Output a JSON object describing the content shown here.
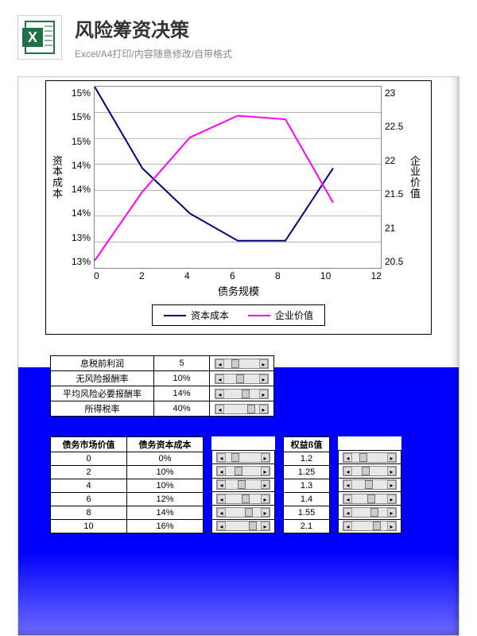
{
  "header": {
    "title": "风险筹资决策",
    "subtitle": "Excel/A4打印/内容随意修改/自带格式"
  },
  "chart_data": {
    "type": "line",
    "title": "",
    "xlabel": "债务规模",
    "ylabel_left": "资本成本",
    "ylabel_right": "企业价值",
    "x": [
      0,
      2,
      4,
      6,
      8,
      10
    ],
    "xticks": [
      0,
      2,
      4,
      6,
      8,
      10,
      12
    ],
    "yticks_left": [
      "15%",
      "15%",
      "15%",
      "14%",
      "14%",
      "14%",
      "13%",
      "13%"
    ],
    "yticks_right": [
      "23",
      "22.5",
      "22",
      "21.5",
      "21",
      "20.5"
    ],
    "ylim_left_pct": [
      13,
      15
    ],
    "ylim_right": [
      20.5,
      23
    ],
    "series": [
      {
        "name": "资本成本",
        "color": "#000080",
        "axis": "left",
        "values_pct": [
          15.0,
          14.1,
          13.6,
          13.3,
          13.3,
          14.1
        ]
      },
      {
        "name": "企业价值",
        "color": "#ff00ff",
        "axis": "right",
        "values": [
          20.6,
          21.55,
          22.3,
          22.6,
          22.55,
          21.4
        ]
      }
    ],
    "legend": [
      "资本成本",
      "企业价值"
    ]
  },
  "params": [
    {
      "label": "息税前利润",
      "value": "5"
    },
    {
      "label": "无风险报酬率",
      "value": "10%"
    },
    {
      "label": "平均风险必要报酬率",
      "value": "14%"
    },
    {
      "label": "所得税率",
      "value": "40%"
    }
  ],
  "data_table": {
    "headers": {
      "debt_value": "债务市场价值",
      "debt_cost": "债务资本成本",
      "equity_beta": "权益ß值"
    },
    "rows": [
      {
        "debt_value": "0",
        "debt_cost": "0%",
        "equity_beta": "1.2"
      },
      {
        "debt_value": "2",
        "debt_cost": "10%",
        "equity_beta": "1.25"
      },
      {
        "debt_value": "4",
        "debt_cost": "10%",
        "equity_beta": "1.3"
      },
      {
        "debt_value": "6",
        "debt_cost": "12%",
        "equity_beta": "1.4"
      },
      {
        "debt_value": "8",
        "debt_cost": "14%",
        "equity_beta": "1.55"
      },
      {
        "debt_value": "10",
        "debt_cost": "16%",
        "equity_beta": "2.1"
      }
    ]
  },
  "colors": {
    "series1": "#000080",
    "series2": "#ff00ff",
    "panel_bg": "#0000ff"
  }
}
